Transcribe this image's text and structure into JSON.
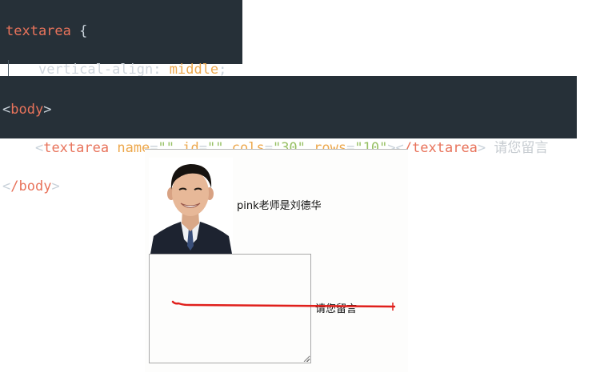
{
  "css_snippet": {
    "selector": "textarea",
    "open_brace": " {",
    "property": "vertical-align",
    "colon": ": ",
    "value": "middle",
    "semicolon": ";",
    "close_brace": "}"
  },
  "html_snippet": {
    "body_open": "body",
    "textarea_tag": "textarea",
    "attr_name_1": "name",
    "attr_value_1": "\"\"",
    "attr_id": "id",
    "attr_id_value": "\"\"",
    "attr_cols": "cols",
    "attr_cols_value": "\"30\"",
    "attr_rows": "rows",
    "attr_rows_value": "\"10\"",
    "textarea_close": "/textarea",
    "trailing_text": "请您留言",
    "body_close": "/body"
  },
  "preview": {
    "photo_caption": "pink老师是刘德华",
    "message_label": "请您留言",
    "textarea_value": ""
  },
  "colors": {
    "code_bg": "#263038",
    "tag": "#e8735b",
    "attribute": "#eda84d",
    "string": "#97c064",
    "annotation": "#e0201c"
  },
  "icons": {
    "avatar": "person-photo",
    "resize": "resize-grip-icon"
  }
}
